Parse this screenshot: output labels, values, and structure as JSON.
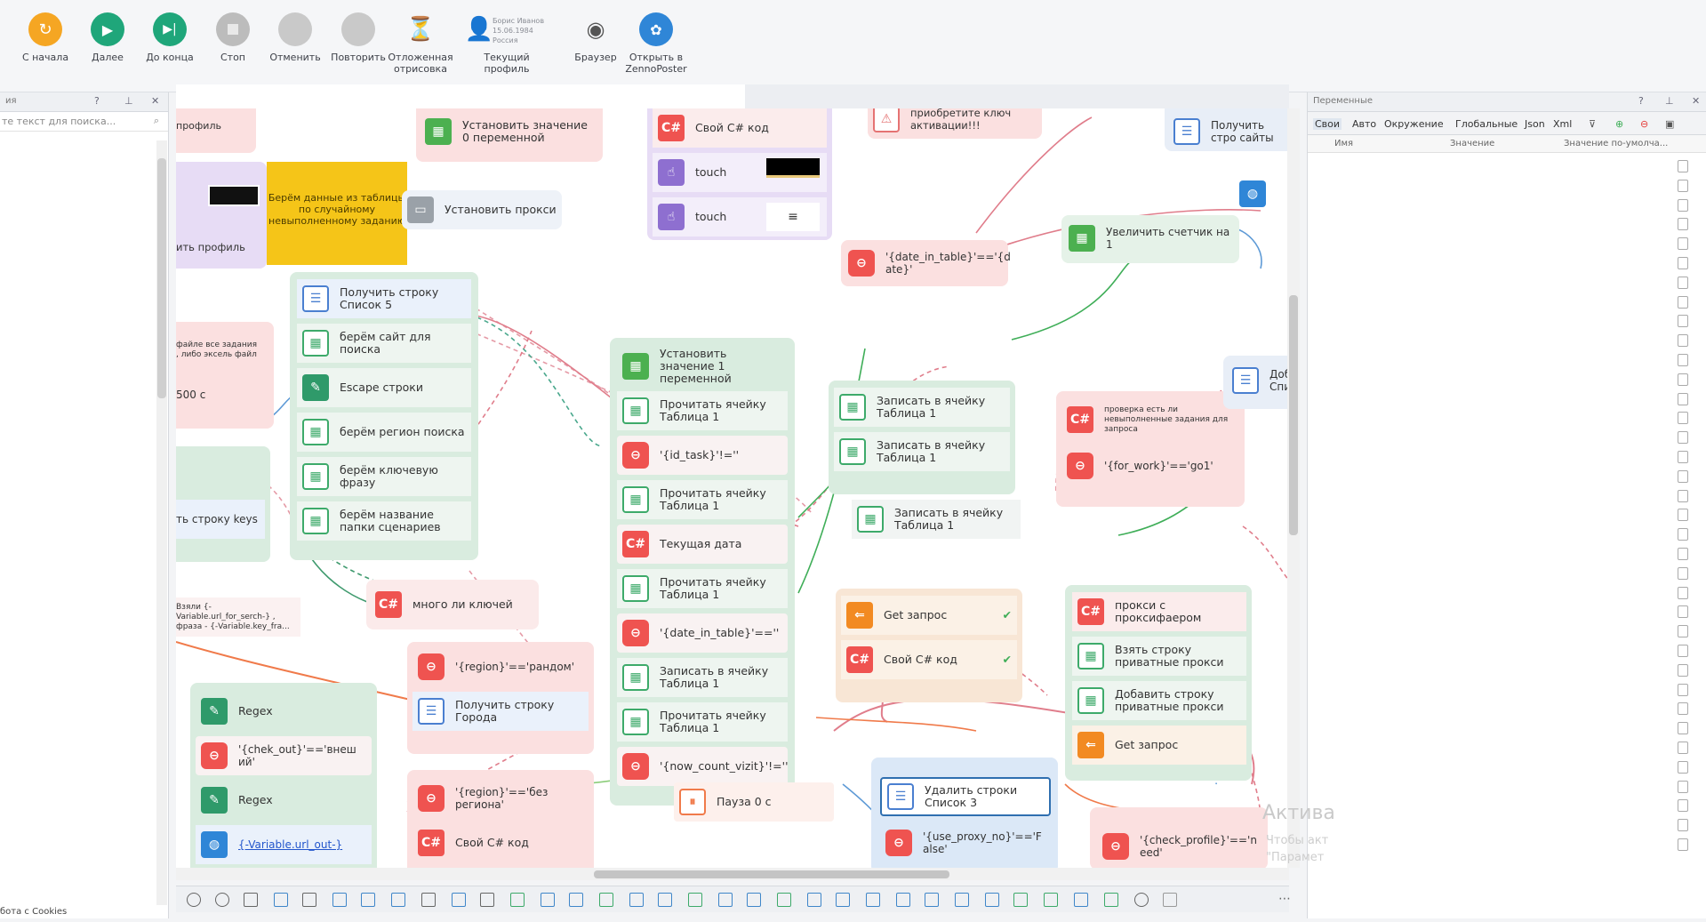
{
  "toolbar": {
    "buttons": [
      {
        "label": "С начала",
        "icon": "restart-icon",
        "color": "#f5a623"
      },
      {
        "label": "Далее",
        "icon": "next-icon",
        "color": "#1fa67a"
      },
      {
        "label": "До конца",
        "icon": "skip-to-end-icon",
        "color": "#1fa67a"
      },
      {
        "label": "Стоп",
        "icon": "stop-icon",
        "color": "#bcbcbc"
      },
      {
        "label": "Отменить",
        "icon": "undo-icon",
        "color": "#c9c9c9"
      },
      {
        "label": "Повторить",
        "icon": "redo-icon",
        "color": "#c9c9c9"
      },
      {
        "label": "Отложенная отрисовка",
        "icon": "hourglass-icon",
        "color": "#d9822b"
      },
      {
        "label": "Текущий профиль",
        "icon": "user-profile-icon",
        "color": "#2f86d7"
      },
      {
        "label": "Браузер",
        "icon": "eye-off-icon",
        "color": "#555"
      },
      {
        "label": "Открыть в ZennoPoster",
        "icon": "zennoposter-icon",
        "color": "#2f86d7"
      }
    ],
    "profile_name": "Борис Иванов",
    "profile_date": "15.06.1984",
    "profile_country": "Россия"
  },
  "left_panel": {
    "title": "ия",
    "search_placeholder": "те текст для поиска...",
    "footer": "бота с Cookies"
  },
  "right_panel": {
    "title": "Переменные",
    "tabs": [
      "Свои",
      "Авто",
      "Окружение",
      "Глобальные",
      "Json",
      "Xml"
    ],
    "columns": [
      "Имя",
      "Значение",
      "Значение по-умолча..."
    ]
  },
  "canvas": {
    "sticky_note": "Берём данные из таблицы по случайному невыполненному заданию",
    "nodes": {
      "set_value_0": "Установить значение 0 переменной",
      "own_cs_code_top": "Свой C# код",
      "touch_1": "touch",
      "touch_2": "touch",
      "activation_key": "приобретите ключ активации!!!",
      "get_sites": "Получить стро сайты",
      "set_proxy": "Установить прокси",
      "profile_top": "профиль",
      "profile_left": "ить профиль",
      "date_in_table_check": "'{date_in_table}'=='{d ate}'",
      "inc_counter": "Увеличить счетчик на 1",
      "get_row_list5": "Получить строку Список 5",
      "take_site": "берём сайт для поиска",
      "escape_string": "Escape строки",
      "take_region": "берём регион поиска",
      "take_keyword": "берём ключевую фразу",
      "take_folder": "берём название папки сценариев",
      "file_all_tasks": "файле все задания , либо эксель файл",
      "wait_500": "500 с",
      "get_row_keys": "ть строку keys",
      "add_to_list": "Доба Спис",
      "set_value_1": "Установить значение 1 переменной",
      "read_cell_1": "Прочитать ячейку Таблица 1",
      "id_task_check": "'{id_task}'!=''",
      "read_cell_2": "Прочитать ячейку Таблица 1",
      "current_date": "Текущая дата",
      "read_cell_3": "Прочитать ячейку Таблица 1",
      "date_in_table_empty": "'{date_in_table}'==''",
      "write_cell_a": "Записать в ячейку Таблица 1",
      "read_cell_4": "Прочитать ячейку Таблица 1",
      "now_count_vizit": "'{now_count_vizit}'!=''",
      "write_cell_b": "Записать в ячейку Таблица 1",
      "write_cell_c": "Записать в ячейку Таблица 1",
      "write_cell_d": "Записать в ячейку Таблица 1",
      "check_tasks": "проверка есть ли невыполненные задания для запроса",
      "for_work": "'{for_work}'=='go1'",
      "many_keys": "много ли ключей",
      "take_vars": "Взяли {-Variable.url_for_serch-} , фраза - {-Variable.key_fra...",
      "get_request_1": "Get запрос",
      "own_cs_code_mid": "Свой C# код",
      "proxy_seller": "прокси с проксифаером",
      "take_private_proxy": "Взять строку приватные прокси",
      "add_private_proxy": "Добавить строку приватные прокси",
      "get_request_2": "Get запрос",
      "region_random": "'{region}'=='рандом'",
      "get_row_cities": "Получить строку Города",
      "regex_1": "Regex",
      "chek_out": "'{chek_out}'=='внеш ий'",
      "regex_2": "Regex",
      "url_out": "{-Variable.url_out-}",
      "region_no": "'{region}'=='без региона'",
      "own_cs_code_bottom": "Свой C# код",
      "pause_0": "Пауза 0 с",
      "delete_rows": "Удалить строки Список 3",
      "use_proxy_no": "'{use_proxy_no}'=='F alse'",
      "check_profile": "'{check_profile}'=='n eed'"
    }
  },
  "watermark": {
    "title": "Актива",
    "line1": "Чтобы акт",
    "line2": "\"Парамет"
  }
}
